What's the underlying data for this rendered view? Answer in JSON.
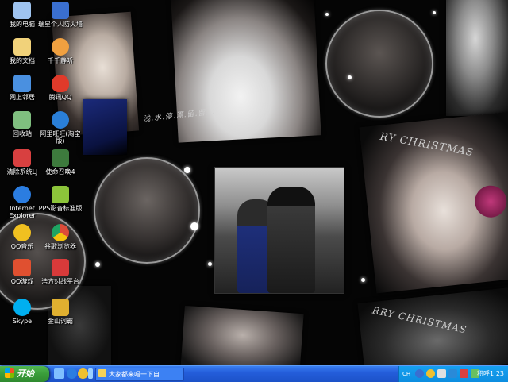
{
  "desktop": {
    "decorations": {
      "handwriting_text": "浅.水.停.漂.留.留...",
      "christmas_text_1": "RY CHRISTMAS",
      "christmas_text_2": "RRY CHRISTMAS"
    },
    "icons": [
      {
        "name": "my-computer",
        "label": "我的电脑",
        "icon": "computer-icon",
        "color": "#9fc4f0"
      },
      {
        "name": "ruixing-firewall",
        "label": "瑞星个人防火墙",
        "icon": "shield-icon",
        "color": "#3a6fd0"
      },
      {
        "name": "my-documents",
        "label": "我的文档",
        "icon": "folder-icon",
        "color": "#f1d27a"
      },
      {
        "name": "ttplayer",
        "label": "千千静听",
        "icon": "music-player-icon",
        "color": "#f0a040"
      },
      {
        "name": "network-places",
        "label": "网上邻居",
        "icon": "network-icon",
        "color": "#4a90e0"
      },
      {
        "name": "tencent-qq",
        "label": "腾讯QQ",
        "icon": "penguin-icon",
        "color": "#e03a2a"
      },
      {
        "name": "recycle-bin",
        "label": "回收站",
        "icon": "recycle-bin-icon",
        "color": "#7fbf7f"
      },
      {
        "name": "aliwangwang",
        "label": "阿里旺旺(淘宝版)",
        "icon": "aliwangwang-icon",
        "color": "#2a7fd8"
      },
      {
        "name": "system-cleaner",
        "label": "清除系统LJ",
        "icon": "cleaner-icon",
        "color": "#d84040"
      },
      {
        "name": "mingzhu-4",
        "label": "使命召唤4",
        "icon": "game-icon",
        "color": "#3d7a3d"
      },
      {
        "name": "internet-explorer",
        "label": "Internet Explorer",
        "icon": "ie-icon",
        "color": "#2b7de1"
      },
      {
        "name": "pps-player",
        "label": "PPS影音标准版",
        "icon": "pps-icon",
        "color": "#8cc43a"
      },
      {
        "name": "qq-music",
        "label": "QQ音乐",
        "icon": "music-icon",
        "color": "#f0c020"
      },
      {
        "name": "google-chrome",
        "label": "谷歌浏览器",
        "icon": "chrome-icon",
        "color": "#dd4b39"
      },
      {
        "name": "qq-game",
        "label": "QQ游戏",
        "icon": "qq-game-icon",
        "color": "#e05030"
      },
      {
        "name": "haofang-platform",
        "label": "浩方对战平台",
        "icon": "haofang-icon",
        "color": "#d83a3a"
      },
      {
        "name": "skype",
        "label": "Skype",
        "icon": "skype-icon",
        "color": "#00aff0"
      },
      {
        "name": "kingsoft-ciba",
        "label": "金山词霸",
        "icon": "dictionary-icon",
        "color": "#e0b030"
      }
    ]
  },
  "taskbar": {
    "start_label": "开始",
    "quick_launch": [
      {
        "icon": "show-desktop-icon",
        "color": "#7fbfff"
      },
      {
        "icon": "ie-quick-icon",
        "color": "#2b7de1"
      },
      {
        "icon": "qq-quick-icon",
        "color": "#f0c030"
      },
      {
        "icon": "media-quick-icon",
        "color": "#9ad0ff"
      }
    ],
    "task_button_label": "大家都来唱一下自...",
    "tray": {
      "items": [
        {
          "icon": "input-method-icon",
          "label": "CH"
        },
        {
          "icon": "help-icon",
          "color": "#3a6fd0"
        },
        {
          "icon": "qq-tray-icon",
          "color": "#f0c030"
        },
        {
          "icon": "speaker-icon",
          "color": "#e0e0e0"
        },
        {
          "icon": "antivirus-tray-icon",
          "color": "#2a8ad8"
        },
        {
          "icon": "network-tray-icon",
          "color": "#d84040"
        },
        {
          "icon": "messenger-tray-icon",
          "color": "#6ac060"
        }
      ],
      "clock": "积呼1:23"
    }
  }
}
